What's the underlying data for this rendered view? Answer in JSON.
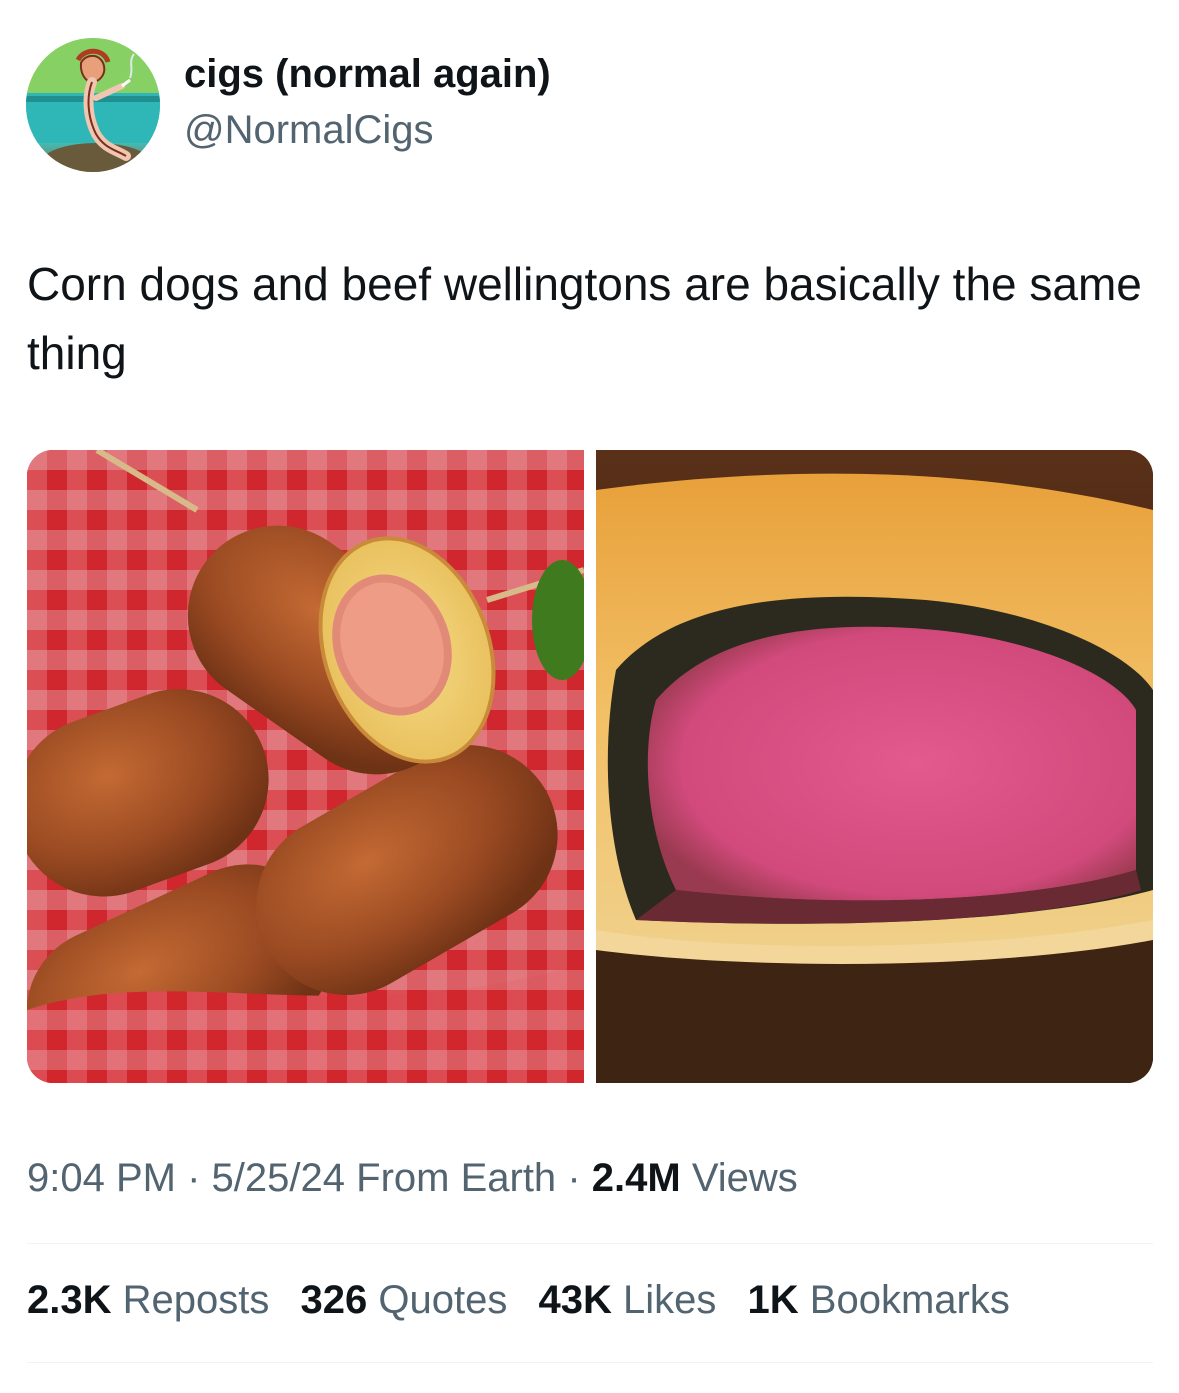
{
  "author": {
    "display_name": "cigs (normal again)",
    "handle": "@NormalCigs",
    "avatar_icon": "cartoon-smoking-figure-avatar"
  },
  "tweet": {
    "text": "Corn dogs and beef wellingtons are basically the same thing"
  },
  "media": {
    "left_image": "corn-dogs-photo",
    "right_image": "beef-wellington-photo"
  },
  "meta": {
    "time": "9:04 PM",
    "sep1": "·",
    "date": "5/25/24",
    "source": "From Earth",
    "sep2": "·",
    "views_count": "2.4M",
    "views_label": "Views"
  },
  "stats": {
    "reposts_count": "2.3K",
    "reposts_label": "Reposts",
    "quotes_count": "326",
    "quotes_label": "Quotes",
    "likes_count": "43K",
    "likes_label": "Likes",
    "bookmarks_count": "1K",
    "bookmarks_label": "Bookmarks"
  },
  "colors": {
    "text_primary": "#0f1419",
    "text_secondary": "#536471",
    "divider": "#eff3f4"
  }
}
